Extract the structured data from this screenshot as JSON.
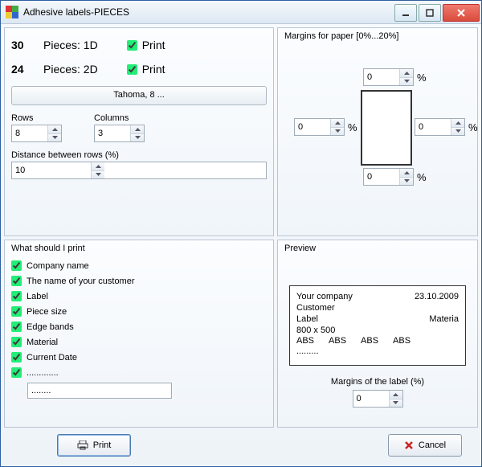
{
  "window": {
    "title": "Adhesive labels-PIECES"
  },
  "pieces": {
    "row1": {
      "count": "30",
      "label": "Pieces: 1D",
      "print_label": "Print"
    },
    "row2": {
      "count": "24",
      "label": "Pieces: 2D",
      "print_label": "Print"
    }
  },
  "font_button": "Tahoma, 8 ...",
  "layout": {
    "rows_label": "Rows",
    "rows": "8",
    "cols_label": "Columns",
    "cols": "3",
    "dist_label": "Distance between rows (%)",
    "dist": "10"
  },
  "margins": {
    "header": "Margins for paper [0%...20%]",
    "top": "0",
    "left": "0",
    "right": "0",
    "bottom": "0",
    "pct": "%"
  },
  "print_what": {
    "header": "What should I print",
    "items": [
      "Company name",
      "The name of your customer",
      "Label",
      "Piece size",
      "Edge bands",
      "Material",
      "Current Date",
      "............."
    ],
    "extra_value": "........"
  },
  "preview": {
    "header": "Preview",
    "company": "Your company",
    "date": "23.10.2009",
    "customer": "Customer",
    "label": "Label",
    "material": "Materia",
    "size": "800 x 500",
    "abs": "ABS",
    "dots": ".........",
    "margins_label_hdr": "Margins of the label (%)",
    "margins_label_val": "0"
  },
  "buttons": {
    "print": "Print",
    "cancel": "Cancel"
  }
}
